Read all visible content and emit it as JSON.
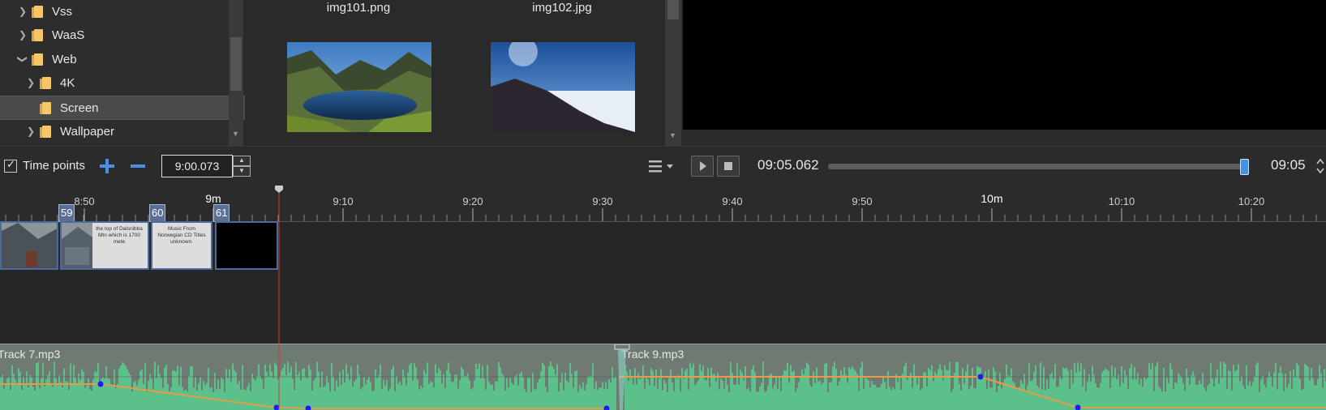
{
  "tree": {
    "items": [
      {
        "label": "Vss",
        "expanded": false,
        "selected": false
      },
      {
        "label": "WaaS",
        "expanded": false,
        "selected": false
      },
      {
        "label": "Web",
        "expanded": true,
        "selected": false
      },
      {
        "label": "4K",
        "expanded": false,
        "selected": false
      },
      {
        "label": "Screen",
        "expanded": false,
        "selected": true
      },
      {
        "label": "Wallpaper",
        "expanded": false,
        "selected": false
      }
    ]
  },
  "browser": {
    "top_labels": [
      "img101.png",
      "img102.jpg"
    ],
    "thumbnails": [
      {
        "name": "lake-mountain-thumbnail"
      },
      {
        "name": "mountain-clouds-thumbnail"
      }
    ]
  },
  "toolbar": {
    "time_points_label": "Time points",
    "time_points_checked": true,
    "time_value": "9:00.073",
    "current_time": "09:05.062",
    "end_time": "09:05",
    "seek_fraction": 0.99
  },
  "ruler": {
    "labels": [
      "8:50",
      "9m",
      "9:10",
      "9:20",
      "9:30",
      "9:40",
      "9:50",
      "10m",
      "10:10",
      "10:20"
    ],
    "major": [
      "9m",
      "10m"
    ]
  },
  "slides": [
    {
      "number": "59",
      "text": "the top of Dalsnibba Mtn which is 1700 mete"
    },
    {
      "number": "60",
      "text": "Music From Norwegian CD Titles unknown."
    },
    {
      "number": "61",
      "text": ""
    }
  ],
  "audio": {
    "tracks": [
      "Track 7.mp3",
      "Track 9.mp3"
    ]
  },
  "colors": {
    "waveform": "#5cc08a",
    "envelope": "#e89a4a",
    "keypoint": "#1a1aff",
    "playhead": "#d33"
  }
}
